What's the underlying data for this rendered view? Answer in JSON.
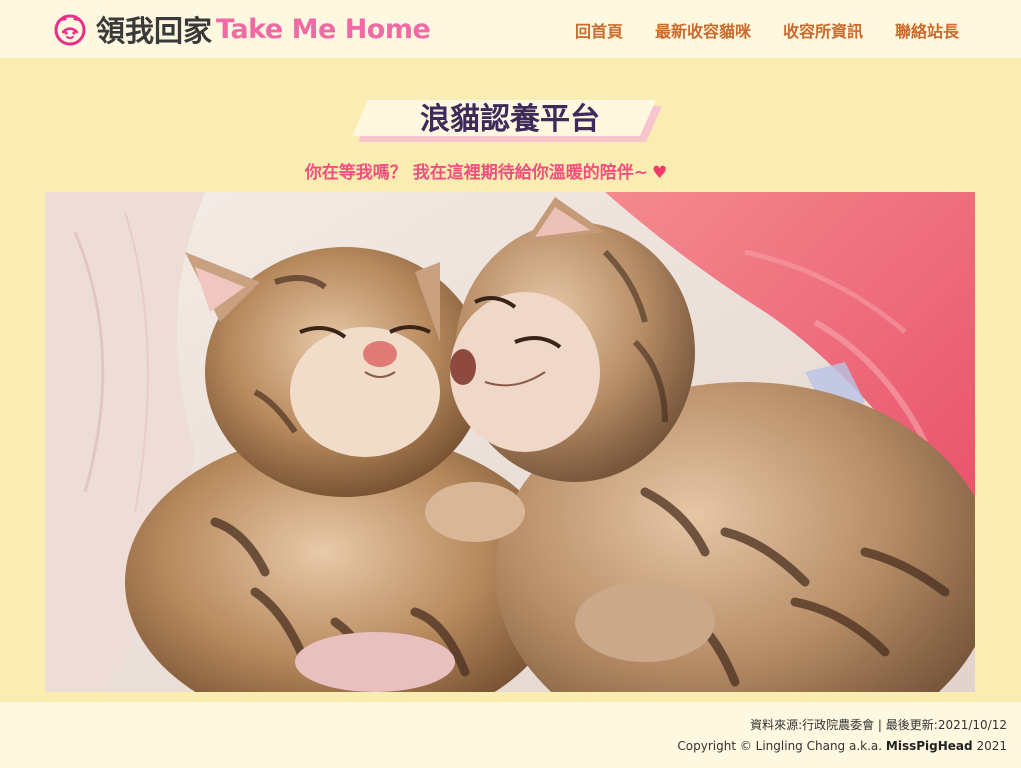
{
  "header": {
    "brand_cn": "領我回家",
    "brand_en": "Take Me Home",
    "logo_icon": "cat-icon",
    "nav": [
      {
        "label": "回首頁"
      },
      {
        "label": "最新收容貓咪"
      },
      {
        "label": "收容所資訊"
      },
      {
        "label": "聯絡站長"
      }
    ]
  },
  "main": {
    "title": "浪貓認養平台",
    "subtitle": "你在等我嗎？ 我在這裡期待給你溫暖的陪伴~",
    "heart": "♥",
    "hero_image": "two-sleeping-tabby-kittens"
  },
  "footer": {
    "source": "資料來源:行政院農委會 | 最後更新:2021/10/12",
    "copyright_prefix": "Copyright © Lingling Chang a.k.a.",
    "author": "MissPigHead",
    "year": "2021"
  },
  "colors": {
    "header_bg": "#fff8e1",
    "main_bg": "#fbedb1",
    "brand_pink": "#f06aa6",
    "nav_orange": "#cc6a2c",
    "title_purple": "#3d2b5a",
    "subtitle_pink": "#f0507f"
  }
}
